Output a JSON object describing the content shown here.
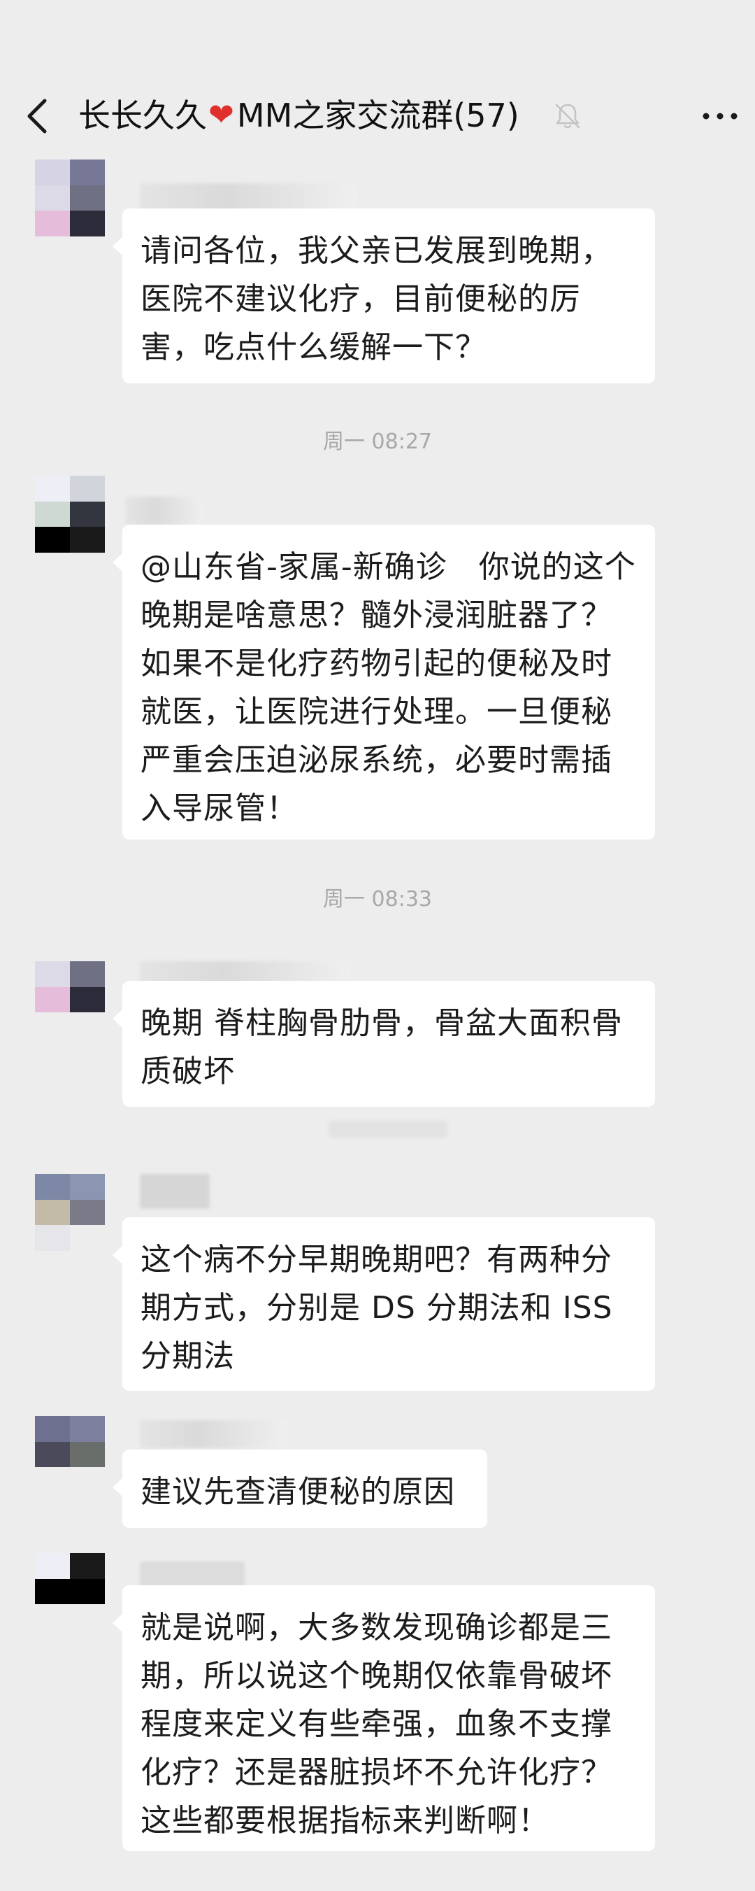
{
  "header": {
    "title_prefix": "长长久久",
    "heart_glyph": "❤",
    "title_suffix": "MM之家交流群(57)"
  },
  "messages": [
    {
      "text": "请问各位，我父亲已发展到晚期，医院不建议化疗，目前便秘的厉害，吃点什么缓解一下？"
    },
    {
      "text": "@山东省-家属-新确诊　你说的这个晚期是啥意思？髓外浸润脏器了？如果不是化疗药物引起的便秘及时就医，让医院进行处理。一旦便秘严重会压迫泌尿系统，必要时需插入导尿管！"
    },
    {
      "text": "晚期 脊柱胸骨肋骨，骨盆大面积骨质破坏"
    },
    {
      "text": "这个病不分早期晚期吧？有两种分期方式，分别是 DS 分期法和 ISS 分期法"
    },
    {
      "text": "建议先查清便秘的原因"
    },
    {
      "text": "就是说啊，大多数发现确诊都是三期，所以说这个晚期仅依靠骨破坏程度来定义有些牵强，血象不支撑化疗？还是器脏损坏不允许化疗？这些都要根据指标来判断啊！"
    }
  ],
  "timestamps": [
    "周一 08:27",
    "周一 08:33"
  ],
  "icons": [
    "back-icon",
    "mute-bell-icon",
    "more-icon"
  ],
  "colors": {
    "background": "#ededed",
    "bubble": "#ffffff",
    "heart": "#e0302e",
    "time": "#a8a8a8"
  }
}
